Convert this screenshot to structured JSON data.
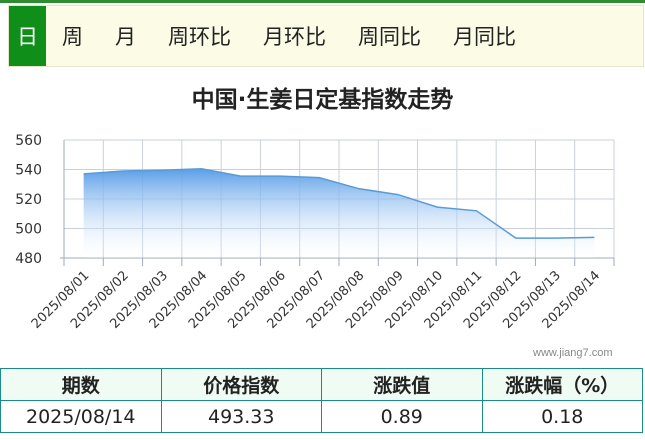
{
  "tabs": [
    {
      "label": "日",
      "active": true
    },
    {
      "label": "周",
      "active": false
    },
    {
      "label": "月",
      "active": false
    },
    {
      "label": "周环比",
      "active": false
    },
    {
      "label": "月环比",
      "active": false
    },
    {
      "label": "周同比",
      "active": false
    },
    {
      "label": "月同比",
      "active": false
    }
  ],
  "chart_data": {
    "type": "area",
    "title": "中国·生姜日定基指数走势",
    "xlabel": "",
    "ylabel": "",
    "x": [
      "2025/08/01",
      "2025/08/02",
      "2025/08/03",
      "2025/08/04",
      "2025/08/05",
      "2025/08/06",
      "2025/08/07",
      "2025/08/08",
      "2025/08/09",
      "2025/08/10",
      "2025/08/11",
      "2025/08/12",
      "2025/08/13",
      "2025/08/14"
    ],
    "values": [
      537,
      539,
      539.5,
      540.5,
      535.5,
      535.5,
      534.5,
      527,
      523,
      514.5,
      512,
      493.5,
      493.5,
      494
    ],
    "yticks": [
      480,
      500,
      520,
      540,
      560
    ],
    "ylim": [
      480,
      560
    ],
    "grid": true,
    "colors": {
      "line": "#5b9bd5",
      "fill_top": "#5a9ee8",
      "fill_bottom": "#ffffff",
      "grid": "#c8d0dc",
      "axis": "#a0aabb"
    }
  },
  "watermark": "www.jiang7.com",
  "summary_table": {
    "headers": [
      "期数",
      "价格指数",
      "涨跌值",
      "涨跌幅（%）"
    ],
    "row": [
      "2025/08/14",
      "493.33",
      "0.89",
      "0.18"
    ]
  }
}
